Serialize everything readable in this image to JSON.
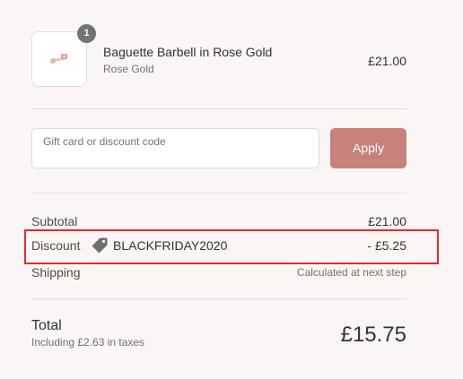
{
  "product": {
    "name": "Baguette Barbell in Rose Gold",
    "variant": "Rose Gold",
    "price": "£21.00",
    "quantity": "1",
    "image_icon": "barbell-earring-icon"
  },
  "discount": {
    "placeholder": "Gift card or discount code",
    "apply_label": "Apply",
    "apply_color": "#c8817b"
  },
  "summary": {
    "subtotal_label": "Subtotal",
    "subtotal_value": "£21.00",
    "discount_label": "Discount",
    "discount_code": "BLACKFRIDAY2020",
    "discount_icon": "tag-icon",
    "discount_value": "- £5.25",
    "shipping_label": "Shipping",
    "shipping_value": "Calculated at next step"
  },
  "total": {
    "label": "Total",
    "taxes_note": "Including £2.63 in taxes",
    "amount": "£15.75"
  },
  "highlight_color": "#e8272d"
}
